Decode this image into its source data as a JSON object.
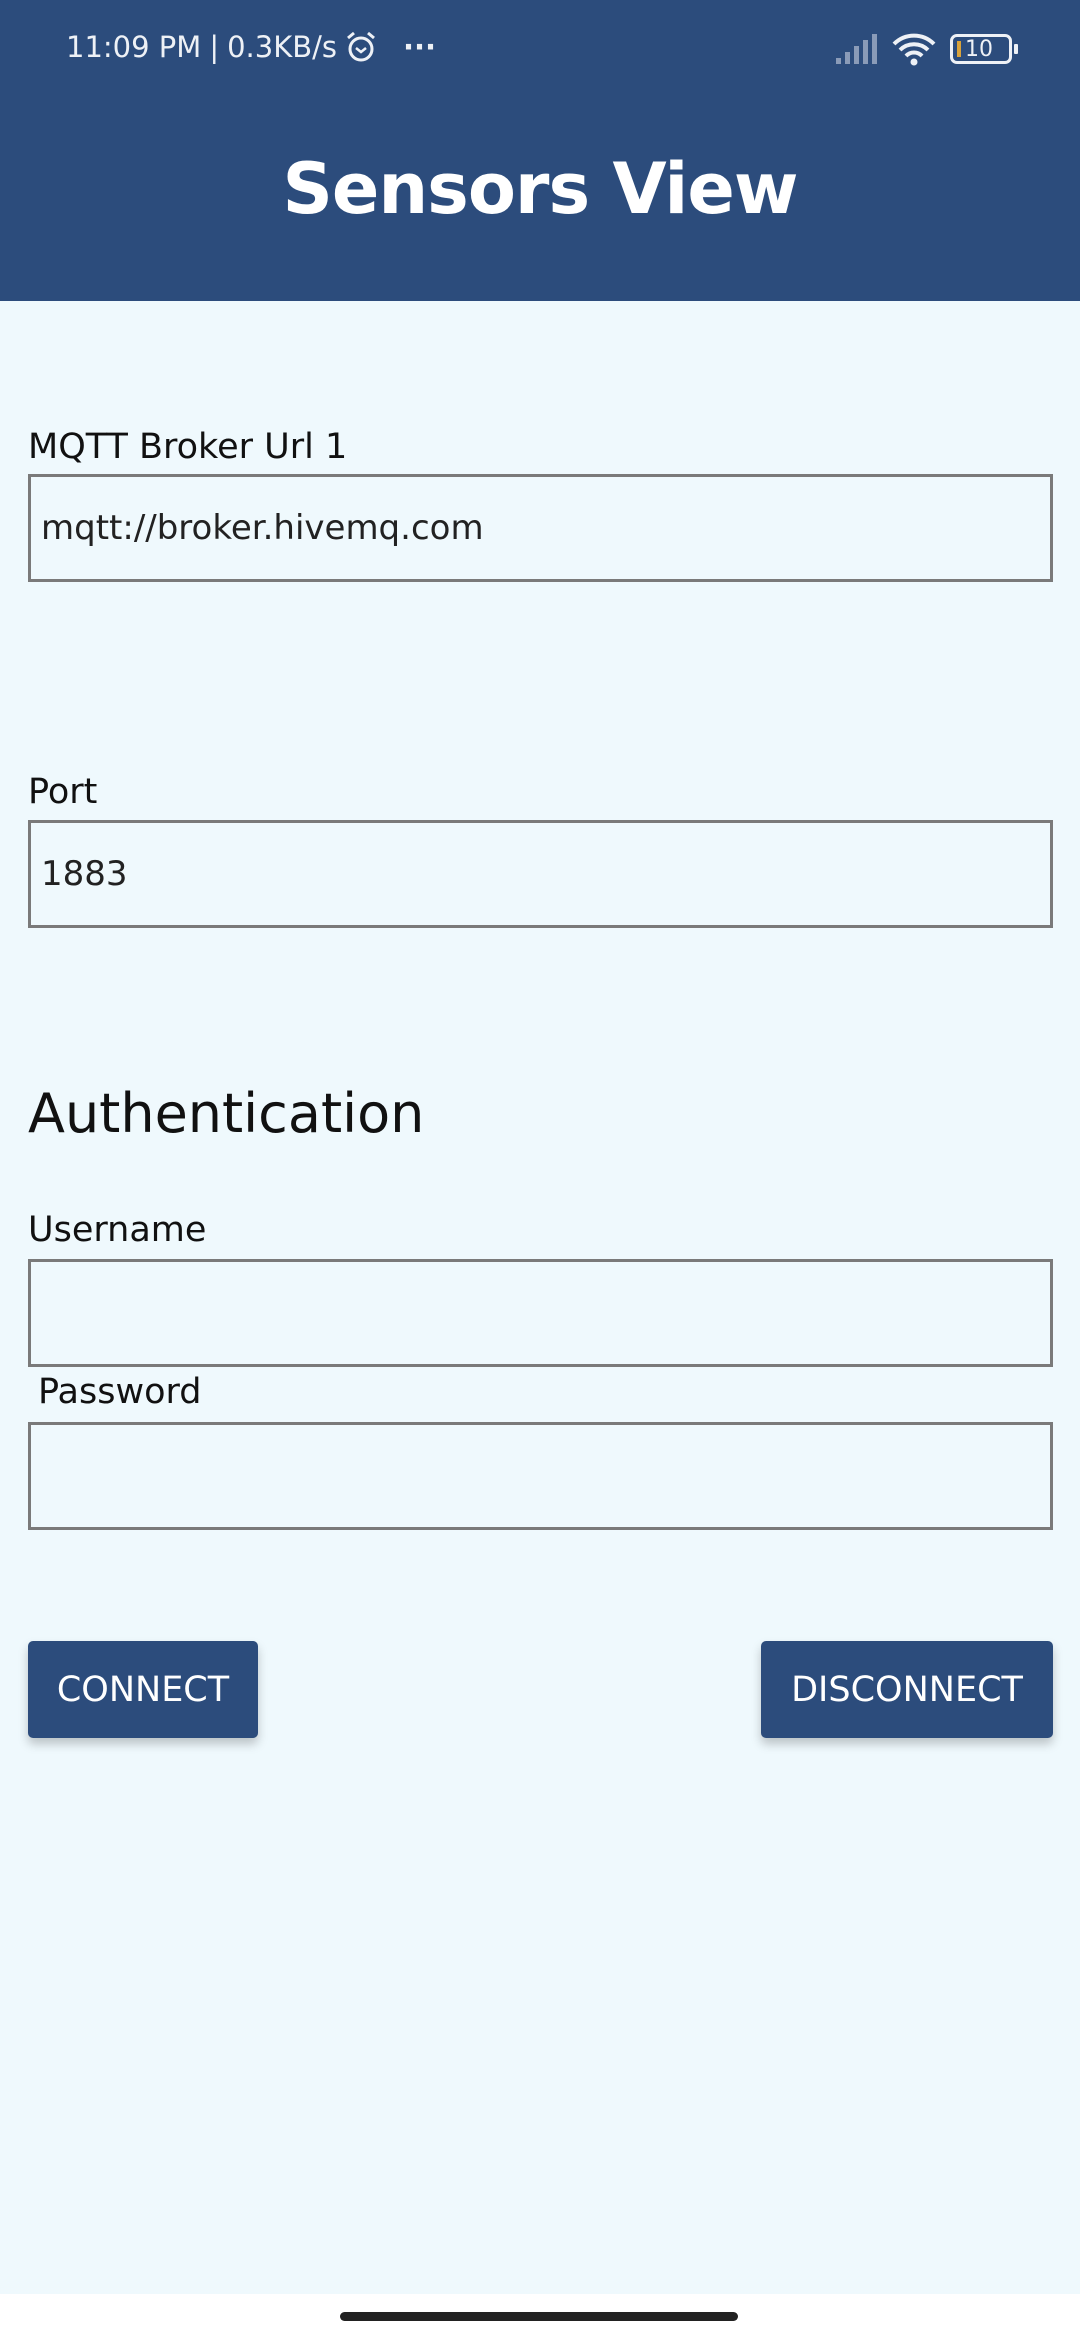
{
  "status_bar": {
    "time": "11:09 PM",
    "separator": "|",
    "speed": "0.3KB/s",
    "more": "···",
    "battery": "10"
  },
  "header": {
    "title": "Sensors View"
  },
  "form": {
    "broker_label": "MQTT Broker Url 1",
    "broker_value": "mqtt://broker.hivemq.com",
    "port_label": "Port",
    "port_value": "1883",
    "auth_heading": "Authentication",
    "username_label": "Username",
    "username_value": "",
    "password_label": "Password",
    "password_value": ""
  },
  "buttons": {
    "connect": "CONNECT",
    "disconnect": "DISCONNECT"
  },
  "colors": {
    "primary": "#2c4c7c",
    "background": "#eff9fd",
    "battery_accent": "#d9a33b"
  }
}
